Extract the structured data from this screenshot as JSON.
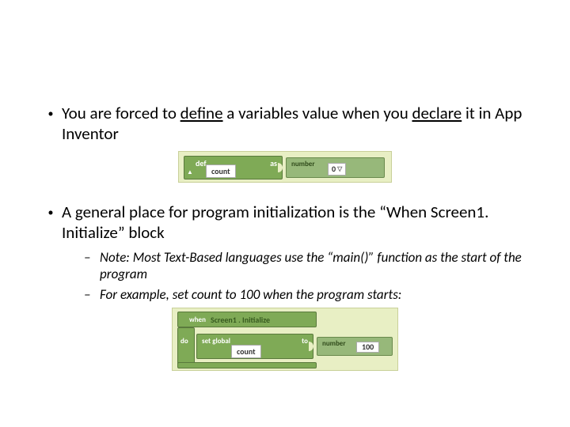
{
  "bullets": {
    "b1": {
      "pre": "You are forced to ",
      "define": "define",
      "mid": " a variables value when you ",
      "declare": "declare",
      "post": " it in App Inventor"
    },
    "b2": "A general place for program initialization is the “When Screen1. Initialize” block",
    "sub1": "Note: Most Text-Based languages use the “main()” function as the start of the program",
    "sub2": "For example, set count to 100 when the program starts:"
  },
  "block1": {
    "def": "def",
    "as": "as",
    "varname": "count",
    "number": "number",
    "value": "0"
  },
  "block2": {
    "when": "when",
    "do": "do",
    "event": "Screen1 . Initialize",
    "setglobal": "set global",
    "to": "to",
    "varname": "count",
    "number": "number",
    "value": "100"
  }
}
